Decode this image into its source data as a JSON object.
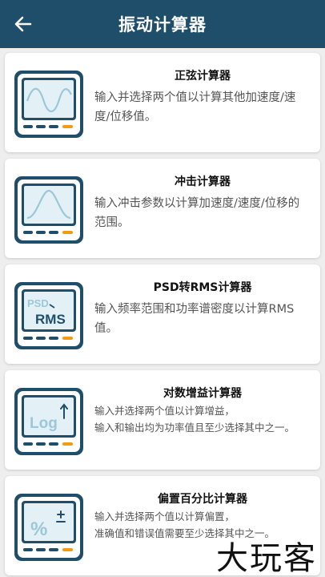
{
  "header": {
    "title": "振动计算器"
  },
  "calculators": [
    {
      "title": "正弦计算器",
      "desc": "输入并选择两个值以计算其他加速度/速度/位移值。"
    },
    {
      "title": "冲击计算器",
      "desc": "输入冲击参数以计算加速度/速度/位移的范围。"
    },
    {
      "title": "PSD转RMS计算器",
      "desc": "输入频率范围和功率谱密度以计算RMS值。",
      "icon_text_top": "PSD",
      "icon_text_bottom": "RMS"
    },
    {
      "title": "对数增益计算器",
      "desc_lines": [
        "输入并选择两个值以计算增益，",
        "输入和输出均为功率值且至少选择其中之一。"
      ],
      "icon_text": "Log"
    },
    {
      "title": "偏置百分比计算器",
      "desc_lines": [
        "输入并选择两个值以计算偏置，",
        "准确值和错误值需要至少选择其中之一。"
      ],
      "icon_text": "%"
    }
  ],
  "watermark": "大玩客",
  "colors": {
    "appbar": "#1f4e6b",
    "icon_dark": "#1f4e6b",
    "icon_light": "#e3f1f7",
    "icon_curve": "#9bc7d8",
    "icon_led": "#f39c12"
  }
}
